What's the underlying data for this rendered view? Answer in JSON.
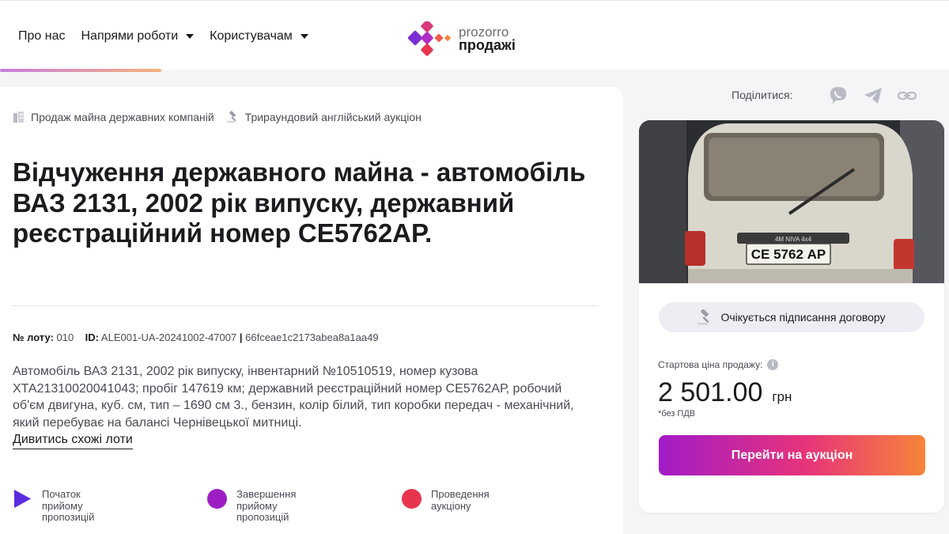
{
  "nav": {
    "items": [
      {
        "label": "Про нас",
        "dropdown": false
      },
      {
        "label": "Напрями роботи",
        "dropdown": true
      },
      {
        "label": "Користувачам",
        "dropdown": true
      }
    ]
  },
  "logo": {
    "line1": "prozorro",
    "line2": "продажі"
  },
  "tags": {
    "category": "Продаж майна державних компаній",
    "auction_type": "Трираундовий англійський аукціон"
  },
  "lot": {
    "title": "Відчуження державного майна - автомобіль ВАЗ 2131, 2002 рік випуску, державний реєстраційний номер СЕ5762АР.",
    "lot_label": "№ лоту:",
    "lot_number": "010",
    "id_label": "ID:",
    "id_value": "ALE001-UA-20241002-47007",
    "separator": "|",
    "hash": "66fceae1c2173abea8a1aa49",
    "description": "Автомобіль ВАЗ 2131, 2002 рік випуску, інвентарний №10510519, номер кузова ХТА21310020041043; пробіг 147619 км; державний реєстраційний номер СЕ5762АР, робочий об'єм двигуна, куб. см, тип – 1690 см 3., бензин, колір білий, тип коробки передач - механічний, який перебуває на балансі Чернівецької митниці.",
    "similar_link": "Дивитись схожі лоти"
  },
  "timeline": [
    {
      "label": "Початок прийому пропозицій",
      "color": "#5b2ce0",
      "shape": "triangle"
    },
    {
      "label": "Завершення прийому пропозицій",
      "color": "#9d1fc4",
      "shape": "circle"
    },
    {
      "label": "Проведення аукціону",
      "color": "#e8354d",
      "shape": "circle"
    }
  ],
  "share": {
    "label": "Поділитися:",
    "icons": [
      "viber-icon",
      "telegram-icon",
      "link-icon"
    ]
  },
  "sidebar": {
    "photo_plate": "СЕ 5762 АР",
    "photo_badge": "4M NIVA 4x4",
    "status": "Очікується підписання договору",
    "price_label": "Стартова ціна продажу:",
    "price_value": "2 501.00",
    "currency": "грн",
    "vat_note": "*без ПДВ",
    "cta_label": "Перейти на аукціон"
  },
  "colors": {
    "accent_gradient": [
      "#a21bc8",
      "#e7337a",
      "#f7853a"
    ],
    "text_primary": "#1b1b1f",
    "text_secondary": "#4a4a55"
  }
}
